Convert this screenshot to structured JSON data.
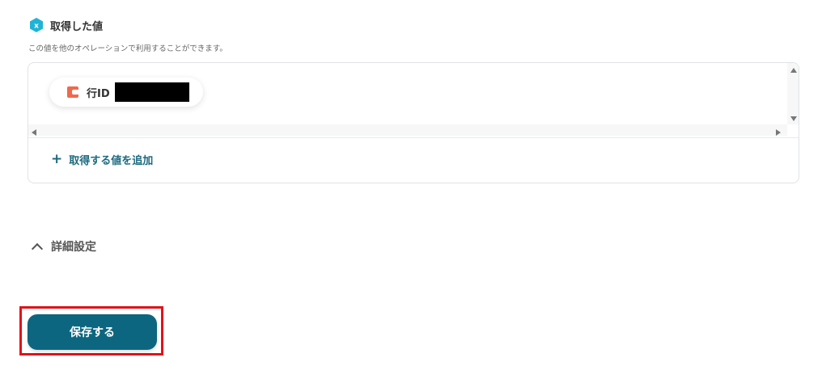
{
  "section": {
    "title": "取得した値",
    "description": "この値を他のオペレーションで利用することができます。",
    "icon": "hexagon-x-icon"
  },
  "values": {
    "items": [
      {
        "label": "行ID",
        "icon": "red-square-icon",
        "value_redacted": true
      }
    ],
    "add_label": "取得する値を追加"
  },
  "advanced": {
    "label": "詳細設定"
  },
  "actions": {
    "save_label": "保存する"
  },
  "colors": {
    "primary": "#0d667f",
    "link": "#1d6a80",
    "chip_icon": "#ef6a4c",
    "highlight": "#e0121b",
    "hex_icon": "#1fb4d6"
  }
}
